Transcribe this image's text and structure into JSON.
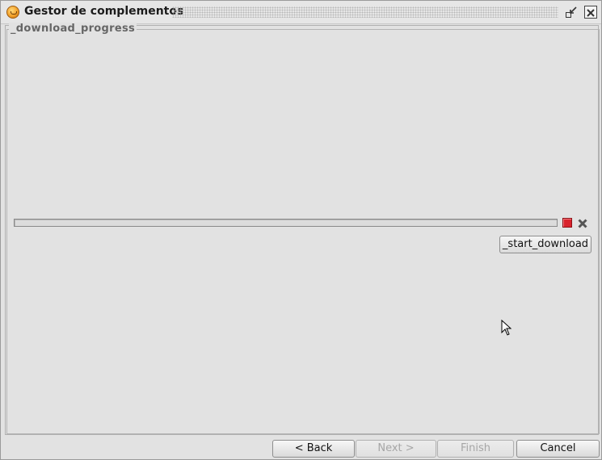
{
  "window": {
    "title": "Gestor de complementos",
    "icons": {
      "app": "app-logo-icon",
      "restore": "restore-icon",
      "close": "close-icon"
    }
  },
  "download": {
    "group_title": "_download_progress",
    "progress_fraction": 0,
    "stop_icon": "stop-icon",
    "cancel_icon": "cancel-x-icon",
    "colors": {
      "stop": "#d9232d"
    },
    "start_button": "_start_download"
  },
  "wizard": {
    "back_label": "< Back",
    "next_label": "Next >",
    "finish_label": "Finish",
    "cancel_label": "Cancel",
    "next_enabled": false,
    "finish_enabled": false
  }
}
